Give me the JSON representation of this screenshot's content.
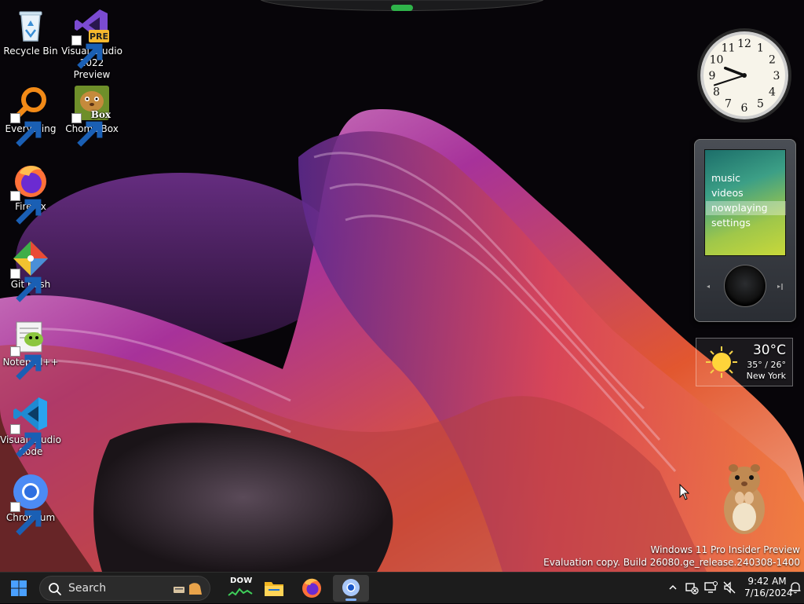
{
  "desktop": {
    "icons": [
      {
        "id": "recycle-bin",
        "label": "Recycle Bin"
      },
      {
        "id": "visual-studio-2022-preview",
        "label": "Visual Studio 2022 Preview",
        "badge": "PRE"
      },
      {
        "id": "everything",
        "label": "Everything"
      },
      {
        "id": "chomikbox",
        "label": "ChomikBox",
        "badge": "Box"
      },
      {
        "id": "firefox",
        "label": "Firefox"
      },
      {
        "id": "git-bash",
        "label": "Git Bash"
      },
      {
        "id": "notepad-plus-plus",
        "label": "Notepad++"
      },
      {
        "id": "visual-studio-code",
        "label": "Visual Studio Code"
      },
      {
        "id": "chromium",
        "label": "Chromium"
      }
    ]
  },
  "gadgets": {
    "clock": {
      "numbers": [
        "12",
        "1",
        "2",
        "3",
        "4",
        "5",
        "6",
        "7",
        "8",
        "9",
        "10",
        "11"
      ],
      "hour": 9,
      "minute": 42
    },
    "zune": {
      "menu": [
        "music",
        "videos",
        "nowplaying",
        "settings"
      ],
      "selected": "nowplaying"
    },
    "weather": {
      "temp": "30°C",
      "range": "35° / 26°",
      "city": "New York",
      "icon": "sun-icon"
    }
  },
  "watermark": {
    "line1": "Windows 11 Pro Insider Preview",
    "line2": "Evaluation copy. Build 26080.ge_release.240308-1400"
  },
  "taskbar": {
    "search_placeholder": "Search",
    "dow_label": "DOW",
    "clock_time": "9:42 AM",
    "clock_date": "7/16/2024",
    "colors": {
      "bg": "#1c1c1c",
      "accent": "#4aa0ff"
    }
  }
}
